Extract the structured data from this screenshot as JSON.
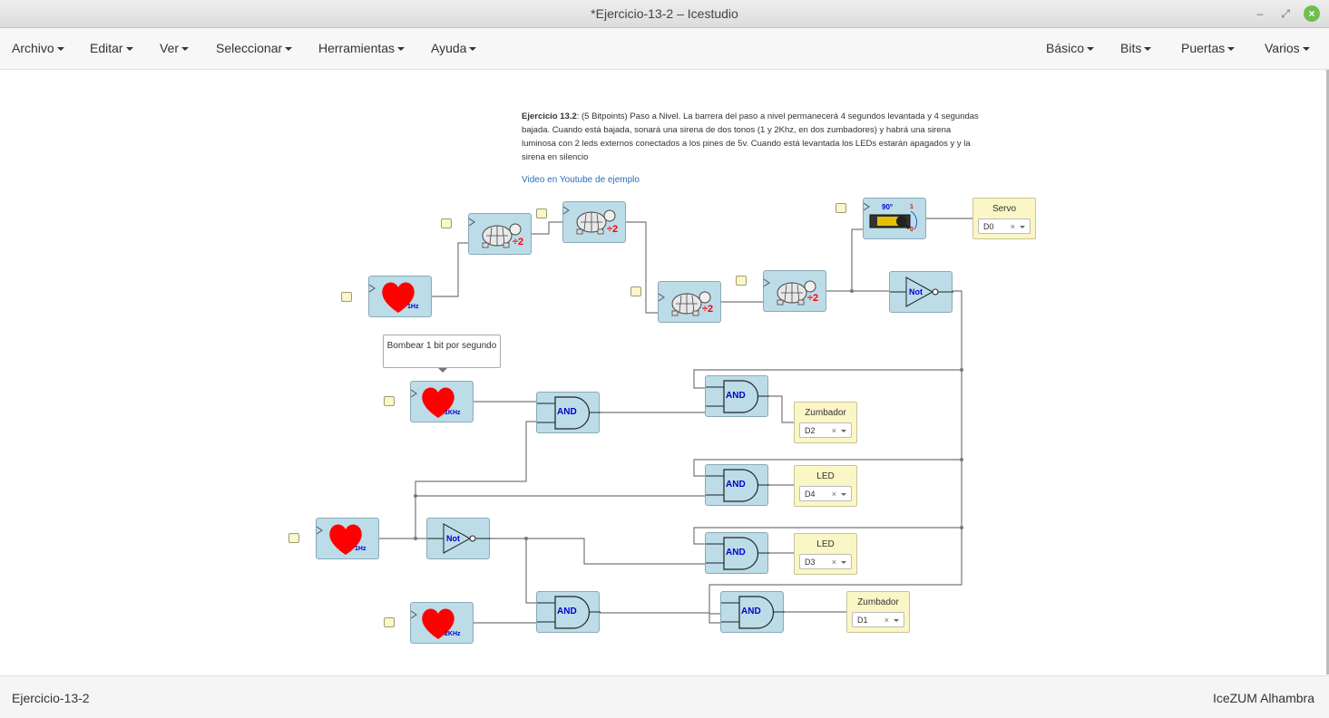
{
  "window": {
    "title": "*Ejercicio-13-2 – Icestudio"
  },
  "menu": {
    "left": [
      "Archivo",
      "Editar",
      "Ver",
      "Seleccionar",
      "Herramientas",
      "Ayuda"
    ],
    "right": [
      "Básico",
      "Bits",
      "Puertas",
      "Varios"
    ]
  },
  "description": {
    "bold": "Ejercicio 13.2",
    "text": ": (5 Bitpoints) Paso a Nivel. La barrera del paso a nivel permanecerá 4 segundos levantada y 4 segundas bajada. Cuando está bajada, sonará una sirena de dos tonos (1 y 2Khz, en dos zumbadores) y habrá una sirena luminosa con 2 leds externos conectados a los pines de 5v. Cuando está levantada los LEDs estarán apagados y y la sirena en silencio",
    "link": "Video en Youtube de ejemplo"
  },
  "comment": "Bombear 1 bit por segundo",
  "blocks": {
    "heart_1hz_top": "1Hz",
    "heart_1khz": "1KHz",
    "heart_1hz_bottom": "1Hz",
    "heart_2khz": "2KHz",
    "divider_label": "÷2",
    "not_label": "Not",
    "and_label": "AND",
    "servo_angle_top": "90°",
    "servo_angle_1": "1",
    "servo_angle_0": "0"
  },
  "outputs": {
    "servo": {
      "label": "Servo",
      "pin": "D0"
    },
    "zumbador1": {
      "label": "Zumbador",
      "pin": "D2"
    },
    "led1": {
      "label": "LED",
      "pin": "D4"
    },
    "led2": {
      "label": "LED",
      "pin": "D3"
    },
    "zumbador2": {
      "label": "Zumbador",
      "pin": "D1"
    }
  },
  "status": {
    "left": "Ejercicio-13-2",
    "right": "IceZUM Alhambra"
  },
  "colors": {
    "block": "#bcdce8",
    "heart": "#ff0000",
    "gate_text": "#0000cc",
    "divider_text": "#ff0000"
  }
}
